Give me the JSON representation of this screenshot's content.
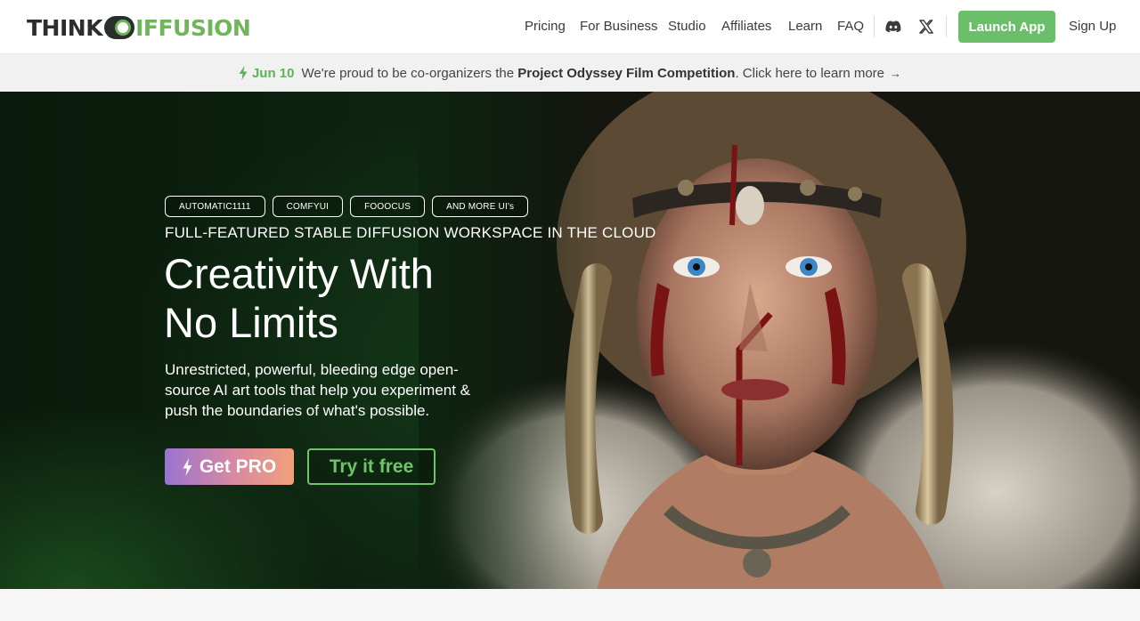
{
  "brand": {
    "think": "THINK",
    "diffusion": "IFFUSION",
    "logo_colors": {
      "dark": "#2a2f2b",
      "green": "#6fb55a"
    }
  },
  "nav": {
    "links": [
      "Pricing",
      "For Business",
      "Studio",
      "Affiliates",
      "Learn",
      "FAQ"
    ],
    "icons": [
      "discord-icon",
      "x-twitter-icon"
    ],
    "launch_label": "Launch App",
    "signup_label": "Sign Up"
  },
  "announcement": {
    "date": "Jun 10",
    "text_before": "We're proud to be co-organizers the",
    "highlight": "Project Odyssey Film Competition",
    "text_after": ". Click here to learn more",
    "arrow": "→"
  },
  "hero": {
    "chips": [
      "AUTOMATIC1111",
      "COMFYUI",
      "FOOOCUS",
      "AND MORE UI's"
    ],
    "tagline": "FULL-FEATURED STABLE DIFFUSION WORKSPACE IN THE CLOUD",
    "headline_line1": "Creativity With",
    "headline_line2": "No Limits",
    "description": "Unrestricted, powerful, bleeding edge open-source AI art tools that help you experiment & push the boundaries of what's possible.",
    "pro_label": "Get PRO",
    "free_label": "Try it free"
  },
  "colors": {
    "accent_green": "#6cbf6a",
    "pro_gradient_start": "#9b74d0",
    "pro_gradient_end": "#f0a07a"
  }
}
